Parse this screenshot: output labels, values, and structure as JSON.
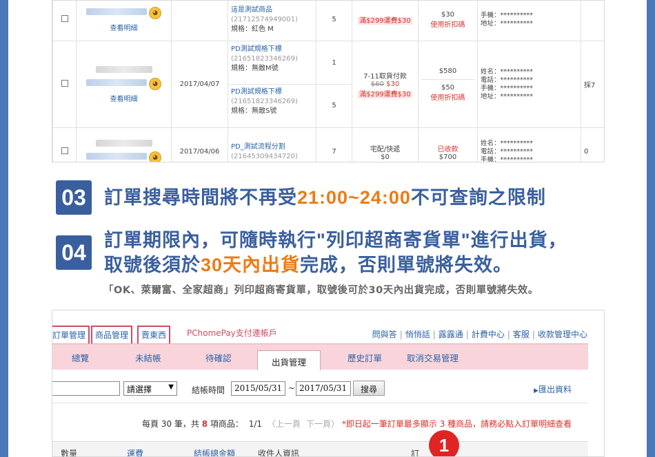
{
  "orders": {
    "detail_label": "查看明細",
    "rows": [
      {
        "date": "",
        "items": [
          {
            "name": "這是測試商品",
            "code": "(21712574949001)",
            "spec": "規格：紅色 M",
            "qty": "5"
          }
        ],
        "shipping": {
          "method": "",
          "price_old": "",
          "price_new": "",
          "note": "滿$299運費$30"
        },
        "amounts": [
          {
            "value": "$30",
            "label": "使用折扣碼"
          }
        ],
        "info": [
          "手機：**********",
          "地址：**********"
        ],
        "extra": ""
      },
      {
        "date": "2017/04/07",
        "items": [
          {
            "name": "PD測試規格下標",
            "code": "(21651823346269)",
            "spec": "規格：無敵M號",
            "qty": "1"
          },
          {
            "name": "PD測試規格下標",
            "code": "(21651823346269)",
            "spec": "規格：無敵S號",
            "qty": "5"
          }
        ],
        "shipping": {
          "method": "7-11取貨付款",
          "price_old": "$60",
          "price_new": "$30",
          "note": "滿$299運費$30"
        },
        "amounts": [
          {
            "value": "$580",
            "label": ""
          },
          {
            "value": "$50",
            "label": "使用折扣碼"
          }
        ],
        "info": [
          "姓名：**********",
          "電話：**********",
          "手機：**********",
          "地址：**********"
        ],
        "extra": "採7"
      },
      {
        "date": "2017/04/06",
        "items": [
          {
            "name": "PD_測試流程分割",
            "code": "(21645309434720)",
            "spec": "",
            "qty": "7"
          }
        ],
        "shipping": {
          "method": "宅配/快遞",
          "price_old": "",
          "price_new": "$0",
          "note": ""
        },
        "amounts": [
          {
            "value": "已收款",
            "label": ""
          },
          {
            "value": "$700",
            "label": ""
          }
        ],
        "info": [
          "姓名：**********",
          "電話：**********",
          "手機：**********"
        ],
        "extra": "0"
      }
    ]
  },
  "steps": [
    {
      "number": "03",
      "line1_a": "訂單搜尋時間將不再受",
      "line1_hl": "21:00~24:00",
      "line1_b": "不可查詢之限制"
    },
    {
      "number": "04",
      "line1": "訂單期限內，可隨時執行\"列印超商寄貨單\"進行出貨，",
      "line2_a": "取號後須於",
      "line2_hl": "30天內出貨",
      "line2_b": "完成，否則單號將失效。"
    }
  ],
  "note": "「OK、萊爾富、全家超商」列印超商寄貨單，取號後可於30天內出貨完成，否則單號將失效。",
  "admin": {
    "top_tabs": [
      "訂單管理",
      "商品管理",
      "賣東西"
    ],
    "brand": "PChomePay支付連帳戶",
    "top_links": [
      "問與答",
      "悄悄話",
      "露露通",
      "計費中心",
      "客服",
      "收款管理中心"
    ],
    "tabs": [
      "總覽",
      "未結帳",
      "待確認",
      "出貨管理",
      "歷史訂單",
      "取消交易管理"
    ],
    "active_tab": "出貨管理",
    "filter": {
      "select_value": "請選擇",
      "date_label": "結帳時間",
      "date_from": "2015/05/31",
      "date_sep": "~",
      "date_to": "2017/05/31",
      "search_btn": "搜尋",
      "export": "匯出資料"
    },
    "pager": {
      "prefix": "每頁 30 筆，共 ",
      "count": "8",
      "suffix": " 項商品：",
      "page": "1/1",
      "prev": "〈上一頁",
      "next": "下一頁〉",
      "warning": "*即日起一筆訂單最多顯示 3 種商品，請務必點入訂單明細查看"
    },
    "headers": [
      "數量",
      "運費",
      "結帳總金額",
      "收件人資訊",
      "訂"
    ],
    "badge": "1"
  }
}
